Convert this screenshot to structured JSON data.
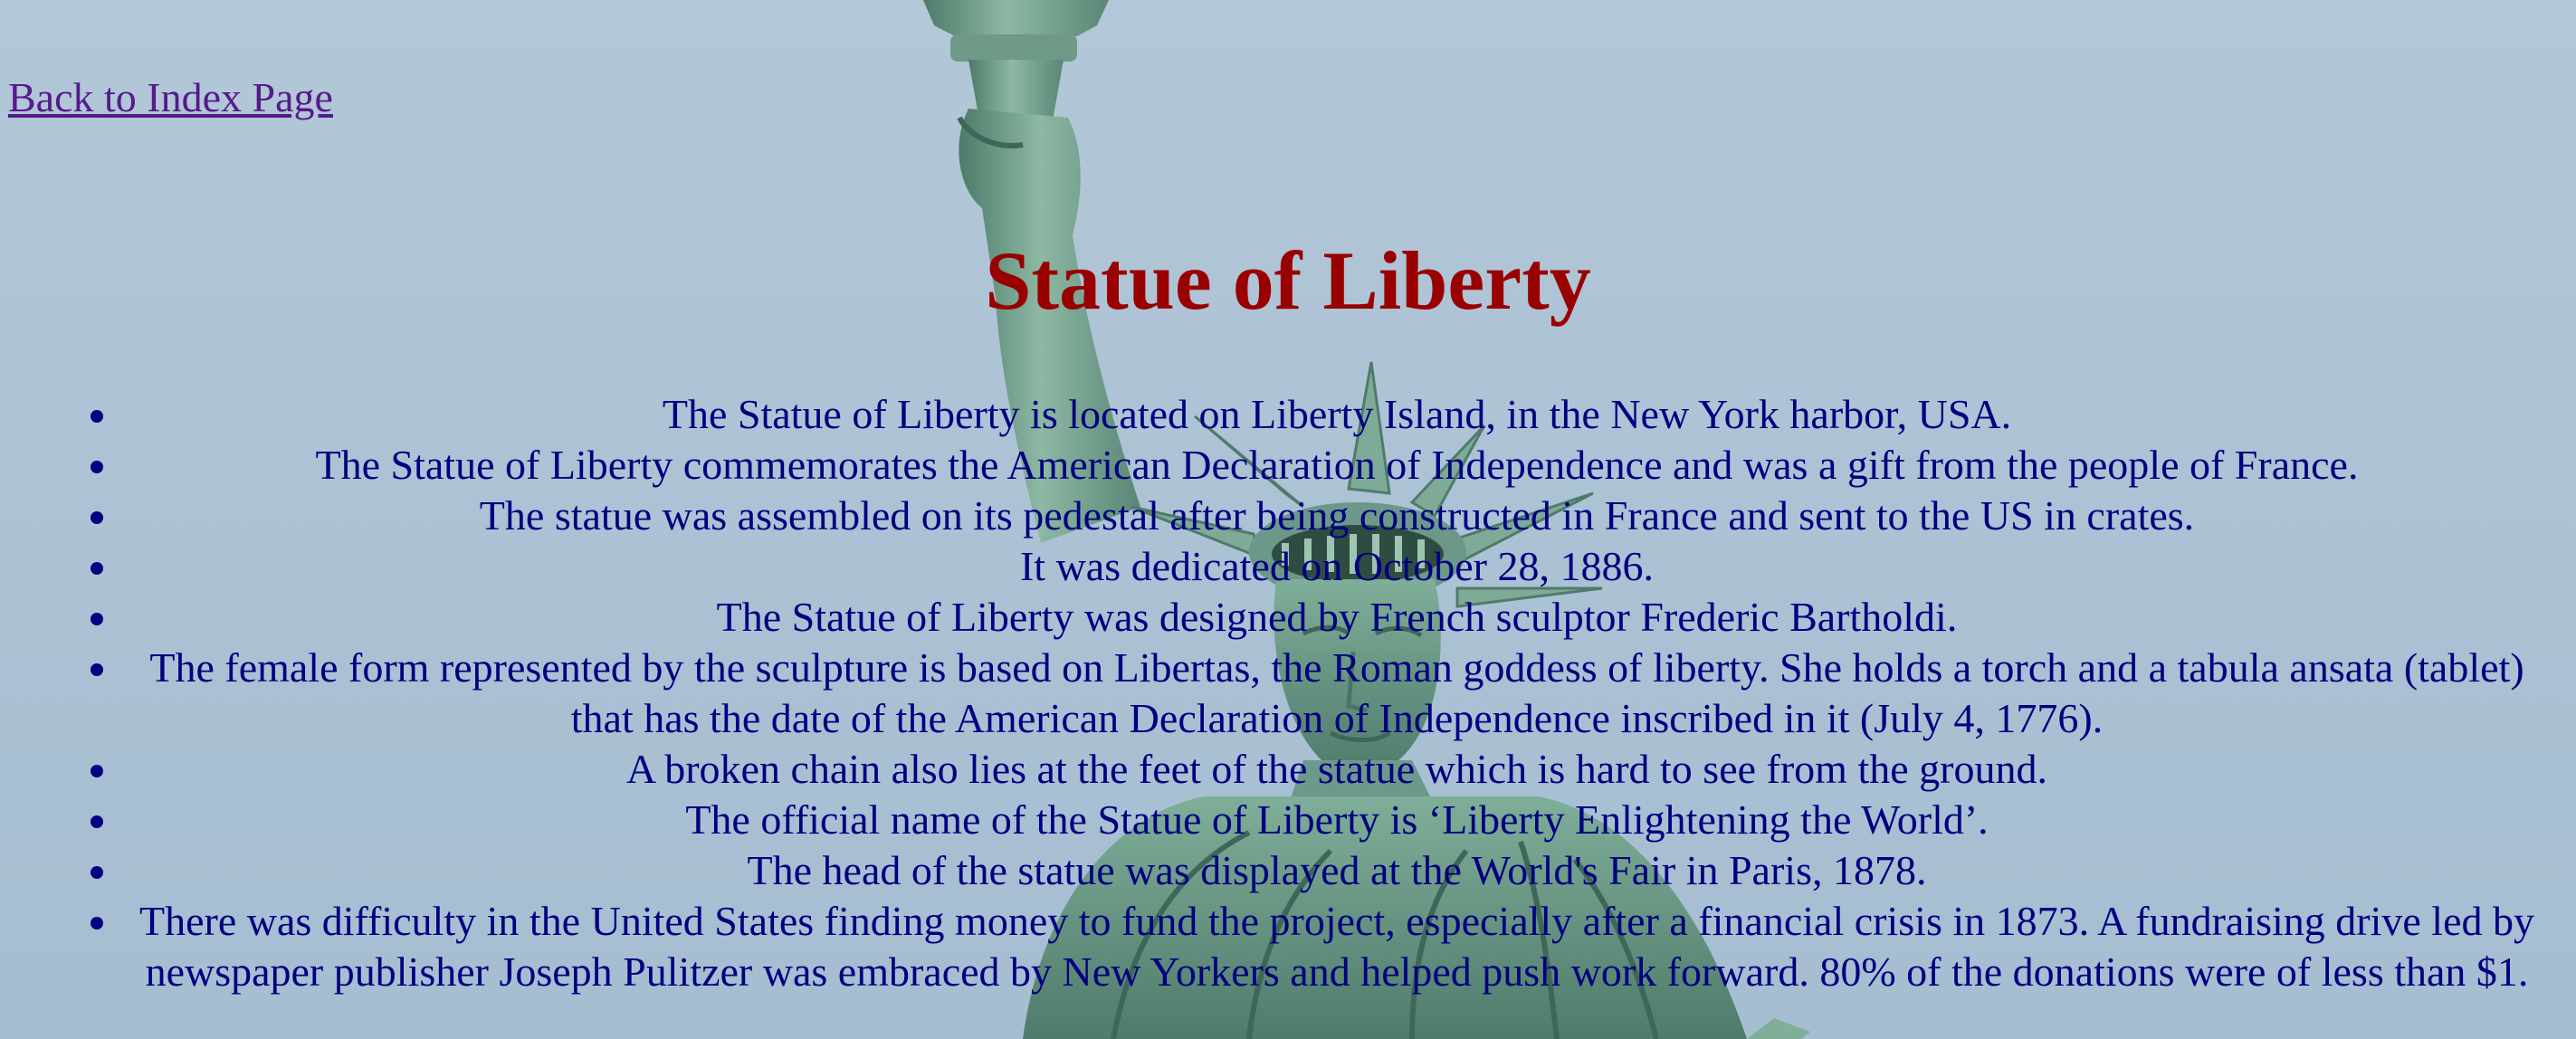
{
  "nav": {
    "back_link": "Back to Index Page"
  },
  "page": {
    "title": "Statue of Liberty"
  },
  "facts": [
    "The Statue of Liberty is located on Liberty Island, in the New York harbor, USA.",
    "The Statue of Liberty commemorates the American Declaration of Independence and was a gift from the people of France.",
    "The statue was assembled on its pedestal after being constructed in France and sent to the US in crates.",
    "It was dedicated on October 28, 1886.",
    "The Statue of Liberty was designed by French sculptor Frederic Bartholdi.",
    "The female form represented by the sculpture is based on Libertas, the Roman goddess of liberty. She holds a torch and a tabula ansata (tablet) that has the date of the American Declaration of Independence inscribed in it (July 4, 1776).",
    "A broken chain also lies at the feet of the statue which is hard to see from the ground.",
    "The official name of the Statue of Liberty is ‘Liberty Enlightening the World’.",
    "The head of the statue was displayed at the World's Fair in Paris, 1878.",
    "There was difficulty in the United States finding money to fund the project, especially after a financial crisis in 1873. A fundraising drive led by newspaper publisher Joseph Pulitzer was embraced by New Yorkers and helped push work forward. 80% of the donations were of less than $1."
  ],
  "colors": {
    "sky": "#aec4d6",
    "statue_copper": "#6f9c8a",
    "title": "#990000",
    "text": "#000080",
    "link": "#551a8b"
  }
}
